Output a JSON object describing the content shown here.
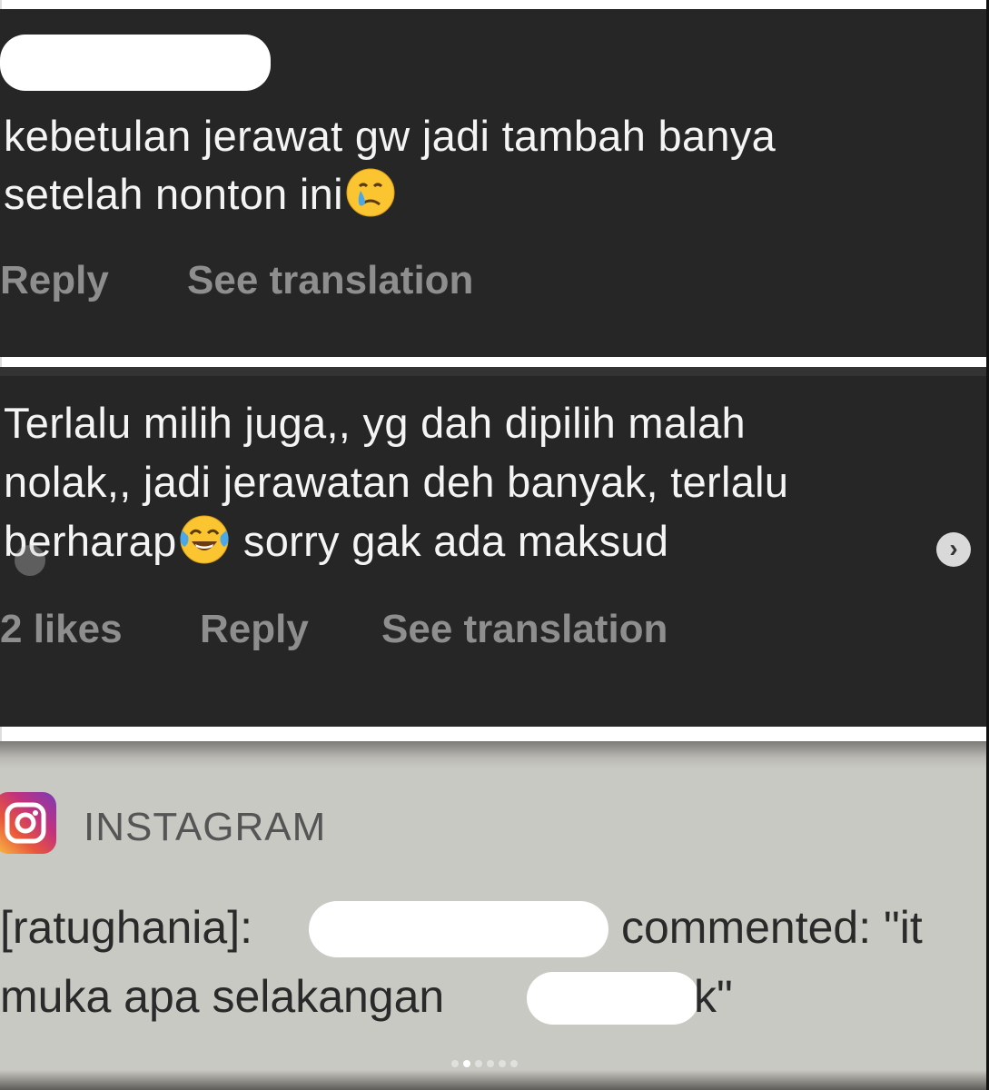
{
  "comment1": {
    "line1": "kebetulan jerawat gw jadi tambah banya",
    "line2": "setelah nonton ini",
    "reaction_emoji": "crying-face-icon",
    "reply_label": "Reply",
    "translate_label": "See translation"
  },
  "comment2": {
    "line1": "Terlalu milih juga,, yg dah dipilih malah",
    "line2": "nolak,, jadi jerawatan deh banyak, terlalu",
    "line3_a": "berharap",
    "line3_b": " sorry gak ada maksud",
    "reaction_emoji": "tears-of-joy-icon",
    "likes_label": "2 likes",
    "reply_label": "Reply",
    "translate_label": "See translation",
    "next_icon_glyph": "›"
  },
  "notification": {
    "app_name": "INSTAGRAM",
    "line1_a": "[ratughania]:",
    "line1_b": "commented: \"it",
    "line2_a": "muka apa selakangan",
    "line2_b": "k\""
  },
  "pager": {
    "count": 6,
    "active": 1
  },
  "colors": {
    "comment_bg": "#262626",
    "comment_text": "#f4f4f4",
    "meta_text": "#8e8e8e",
    "notif_bg": "#c9c9c4"
  }
}
